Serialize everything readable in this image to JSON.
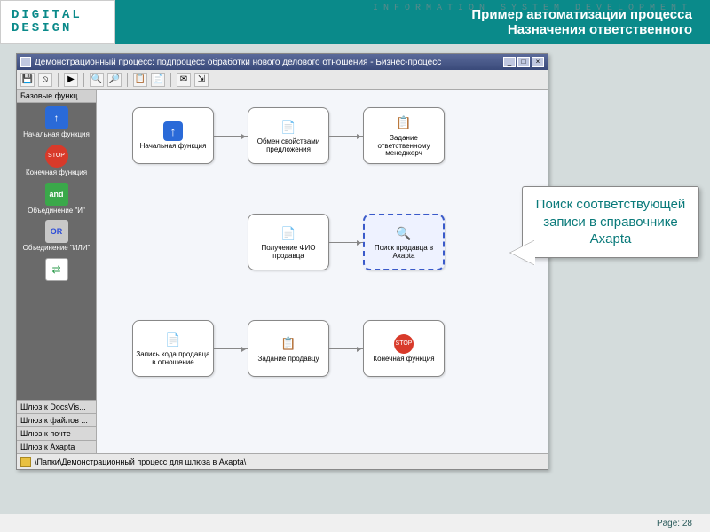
{
  "tagline": "INFORMATION  SYSTEM  DEVELOPMENT",
  "logo": {
    "l1": "DIGITAL",
    "l2": "DESIGN"
  },
  "slide_title": {
    "l1": "Пример автоматизации процесса",
    "l2": "Назначения ответственного"
  },
  "window": {
    "title": "Демонстрационный процесс: подпроцесс обработки нового делового отношения - Бизнес-процесс",
    "status": "\\Папки\\Демонстрационный процесс для шлюза в Axapta\\"
  },
  "palette": {
    "tab": "Базовые функц...",
    "items": [
      {
        "label": "Начальная функция",
        "glyph": "↑",
        "cls": "ic-blue-up"
      },
      {
        "label": "Конечная функция",
        "glyph": "STOP",
        "cls": "ic-stop"
      },
      {
        "label": "Объединение \"И\"",
        "glyph": "and",
        "cls": "ic-and"
      },
      {
        "label": "Объединение \"ИЛИ\"",
        "glyph": "OR",
        "cls": "ic-or"
      },
      {
        "label": "",
        "glyph": "⇄",
        "cls": "ic-swap"
      }
    ],
    "footer": [
      "Шлюз к DocsVis...",
      "Шлюз к файлов ...",
      "Шлюз к почте",
      "Шлюз к Axapta"
    ]
  },
  "nodes": {
    "n1": "Начальная функция",
    "n2": "Обмен свойствами предложения",
    "n3": "Задание ответственному менеджерч",
    "n4": "Получение ФИО продавца",
    "n5": "Поиск продавца в Axapta",
    "n6": "Запись кода продавца в отношение",
    "n7": "Задание продавцу",
    "n8": "Конечная функция"
  },
  "callout": "Поиск соответствующей записи в справочнике Axapta",
  "footer": "Page: 28"
}
